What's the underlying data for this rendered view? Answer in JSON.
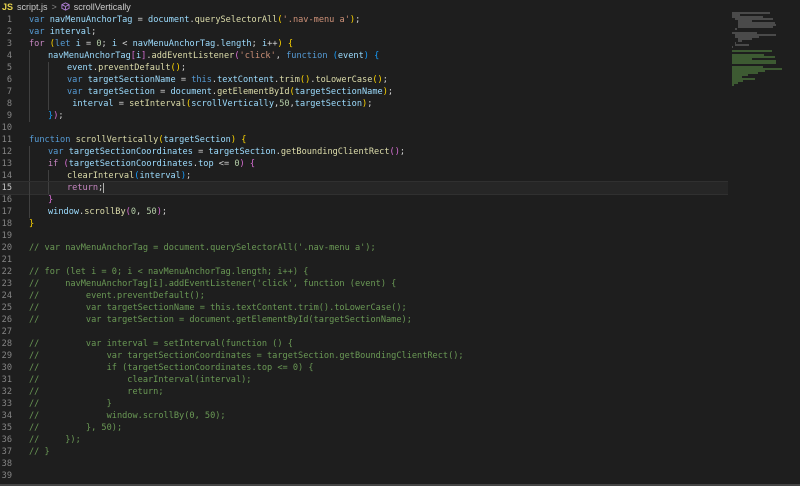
{
  "breadcrumb": {
    "file_badge": "JS",
    "file": "script.js",
    "separator": ">",
    "symbol": "scrollVertically"
  },
  "editor": {
    "current_line": 15,
    "lines": [
      {
        "n": "1",
        "indent": 0,
        "tokens": [
          [
            "k",
            "var "
          ],
          [
            "v",
            "navMenuAnchorTag"
          ],
          [
            "p",
            " = "
          ],
          [
            "v",
            "document"
          ],
          [
            "p",
            "."
          ],
          [
            "f",
            "querySelectorAll"
          ],
          [
            "br",
            "("
          ],
          [
            "s",
            "'.nav-menu a'"
          ],
          [
            "br",
            ")"
          ],
          [
            "p",
            ";"
          ]
        ]
      },
      {
        "n": "2",
        "indent": 0,
        "tokens": [
          [
            "k",
            "var "
          ],
          [
            "v",
            "interval"
          ],
          [
            "p",
            ";"
          ]
        ]
      },
      {
        "n": "3",
        "indent": 0,
        "tokens": [
          [
            "kc",
            "for "
          ],
          [
            "br",
            "("
          ],
          [
            "k",
            "let "
          ],
          [
            "v",
            "i"
          ],
          [
            "p",
            " = "
          ],
          [
            "n",
            "0"
          ],
          [
            "p",
            "; "
          ],
          [
            "v",
            "i"
          ],
          [
            "p",
            " < "
          ],
          [
            "v",
            "navMenuAnchorTag"
          ],
          [
            "p",
            "."
          ],
          [
            "v",
            "length"
          ],
          [
            "p",
            "; "
          ],
          [
            "v",
            "i"
          ],
          [
            "p",
            "++"
          ],
          [
            "br",
            ")"
          ],
          [
            "p",
            " "
          ],
          [
            "br",
            "{"
          ]
        ]
      },
      {
        "n": "4",
        "indent": 1,
        "tokens": [
          [
            "v",
            "navMenuAnchorTag"
          ],
          [
            "br2",
            "["
          ],
          [
            "v",
            "i"
          ],
          [
            "br2",
            "]"
          ],
          [
            "p",
            "."
          ],
          [
            "f",
            "addEventListener"
          ],
          [
            "br2",
            "("
          ],
          [
            "s",
            "'click'"
          ],
          [
            "p",
            ", "
          ],
          [
            "k",
            "function "
          ],
          [
            "br3",
            "("
          ],
          [
            "v",
            "event"
          ],
          [
            "br3",
            ")"
          ],
          [
            "p",
            " "
          ],
          [
            "br3",
            "{"
          ]
        ]
      },
      {
        "n": "5",
        "indent": 2,
        "tokens": [
          [
            "v",
            "event"
          ],
          [
            "p",
            "."
          ],
          [
            "f",
            "preventDefault"
          ],
          [
            "br",
            "()"
          ],
          [
            "p",
            ";"
          ]
        ]
      },
      {
        "n": "6",
        "indent": 2,
        "tokens": [
          [
            "k",
            "var "
          ],
          [
            "v",
            "targetSectionName"
          ],
          [
            "p",
            " = "
          ],
          [
            "k",
            "this"
          ],
          [
            "p",
            "."
          ],
          [
            "v",
            "textContent"
          ],
          [
            "p",
            "."
          ],
          [
            "f",
            "trim"
          ],
          [
            "br",
            "()"
          ],
          [
            "p",
            "."
          ],
          [
            "f",
            "toLowerCase"
          ],
          [
            "br",
            "()"
          ],
          [
            "p",
            ";"
          ]
        ]
      },
      {
        "n": "7",
        "indent": 2,
        "tokens": [
          [
            "k",
            "var "
          ],
          [
            "v",
            "targetSection"
          ],
          [
            "p",
            " = "
          ],
          [
            "v",
            "document"
          ],
          [
            "p",
            "."
          ],
          [
            "f",
            "getElementById"
          ],
          [
            "br",
            "("
          ],
          [
            "v",
            "targetSectionName"
          ],
          [
            "br",
            ")"
          ],
          [
            "p",
            ";"
          ]
        ]
      },
      {
        "n": "8",
        "indent": 2,
        "tokens": [
          [
            "p",
            " "
          ],
          [
            "v",
            "interval"
          ],
          [
            "p",
            " = "
          ],
          [
            "f",
            "setInterval"
          ],
          [
            "br",
            "("
          ],
          [
            "v",
            "scrollVertically"
          ],
          [
            "p",
            ","
          ],
          [
            "n",
            "50"
          ],
          [
            "p",
            ","
          ],
          [
            "v",
            "targetSection"
          ],
          [
            "br",
            ")"
          ],
          [
            "p",
            ";"
          ]
        ]
      },
      {
        "n": "9",
        "indent": 1,
        "tokens": [
          [
            "br3",
            "}"
          ],
          [
            "br2",
            ")"
          ],
          [
            "p",
            ";"
          ]
        ]
      },
      {
        "n": "10",
        "indent": 0,
        "tokens": []
      },
      {
        "n": "11",
        "indent": 0,
        "tokens": [
          [
            "k",
            "function "
          ],
          [
            "f",
            "scrollVertically"
          ],
          [
            "br",
            "("
          ],
          [
            "v",
            "targetSection"
          ],
          [
            "br",
            ")"
          ],
          [
            "p",
            " "
          ],
          [
            "br",
            "{"
          ]
        ]
      },
      {
        "n": "12",
        "indent": 1,
        "tokens": [
          [
            "k",
            "var "
          ],
          [
            "v",
            "targetSectionCoordinates"
          ],
          [
            "p",
            " = "
          ],
          [
            "v",
            "targetSection"
          ],
          [
            "p",
            "."
          ],
          [
            "f",
            "getBoundingClientRect"
          ],
          [
            "br2",
            "()"
          ],
          [
            "p",
            ";"
          ]
        ]
      },
      {
        "n": "13",
        "indent": 1,
        "tokens": [
          [
            "kc",
            "if "
          ],
          [
            "br2",
            "("
          ],
          [
            "v",
            "targetSectionCoordinates"
          ],
          [
            "p",
            "."
          ],
          [
            "v",
            "top"
          ],
          [
            "p",
            " <= "
          ],
          [
            "n",
            "0"
          ],
          [
            "br2",
            ")"
          ],
          [
            "p",
            " "
          ],
          [
            "br2",
            "{"
          ]
        ]
      },
      {
        "n": "14",
        "indent": 2,
        "tokens": [
          [
            "f",
            "clearInterval"
          ],
          [
            "br3",
            "("
          ],
          [
            "v",
            "interval"
          ],
          [
            "br3",
            ")"
          ],
          [
            "p",
            ";"
          ]
        ]
      },
      {
        "n": "15",
        "indent": 2,
        "tokens": [
          [
            "kc",
            "return"
          ],
          [
            "p",
            ";"
          ]
        ]
      },
      {
        "n": "16",
        "indent": 1,
        "tokens": [
          [
            "br2",
            "}"
          ]
        ]
      },
      {
        "n": "17",
        "indent": 1,
        "tokens": [
          [
            "v",
            "window"
          ],
          [
            "p",
            "."
          ],
          [
            "f",
            "scrollBy"
          ],
          [
            "br2",
            "("
          ],
          [
            "n",
            "0"
          ],
          [
            "p",
            ", "
          ],
          [
            "n",
            "50"
          ],
          [
            "br2",
            ")"
          ],
          [
            "p",
            ";"
          ]
        ]
      },
      {
        "n": "18",
        "indent": 0,
        "tokens": [
          [
            "br",
            "}"
          ]
        ]
      },
      {
        "n": "19",
        "indent": 0,
        "tokens": []
      },
      {
        "n": "20",
        "indent": 0,
        "tokens": [
          [
            "c",
            "// var navMenuAnchorTag = document.querySelectorAll('.nav-menu a');"
          ]
        ]
      },
      {
        "n": "21",
        "indent": 0,
        "tokens": []
      },
      {
        "n": "22",
        "indent": 0,
        "tokens": [
          [
            "c",
            "// for (let i = 0; i < navMenuAnchorTag.length; i++) {"
          ]
        ]
      },
      {
        "n": "23",
        "indent": 0,
        "tokens": [
          [
            "c",
            "//     navMenuAnchorTag[i].addEventListener('click', function (event) {"
          ]
        ]
      },
      {
        "n": "24",
        "indent": 0,
        "tokens": [
          [
            "c",
            "//         event.preventDefault();"
          ]
        ]
      },
      {
        "n": "25",
        "indent": 0,
        "tokens": [
          [
            "c",
            "//         var targetSectionName = this.textContent.trim().toLowerCase();"
          ]
        ]
      },
      {
        "n": "26",
        "indent": 0,
        "tokens": [
          [
            "c",
            "//         var targetSection = document.getElementById(targetSectionName);"
          ]
        ]
      },
      {
        "n": "27",
        "indent": 0,
        "tokens": []
      },
      {
        "n": "28",
        "indent": 0,
        "tokens": [
          [
            "c",
            "//         var interval = setInterval(function () {"
          ]
        ]
      },
      {
        "n": "29",
        "indent": 0,
        "tokens": [
          [
            "c",
            "//             var targetSectionCoordinates = targetSection.getBoundingClientRect();"
          ]
        ]
      },
      {
        "n": "30",
        "indent": 0,
        "tokens": [
          [
            "c",
            "//             if (targetSectionCoordinates.top <= 0) {"
          ]
        ]
      },
      {
        "n": "31",
        "indent": 0,
        "tokens": [
          [
            "c",
            "//                 clearInterval(interval);"
          ]
        ]
      },
      {
        "n": "32",
        "indent": 0,
        "tokens": [
          [
            "c",
            "//                 return;"
          ]
        ]
      },
      {
        "n": "33",
        "indent": 0,
        "tokens": [
          [
            "c",
            "//             }"
          ]
        ]
      },
      {
        "n": "34",
        "indent": 0,
        "tokens": [
          [
            "c",
            "//             window.scrollBy(0, 50);"
          ]
        ]
      },
      {
        "n": "35",
        "indent": 0,
        "tokens": [
          [
            "c",
            "//         }, 50);"
          ]
        ]
      },
      {
        "n": "36",
        "indent": 0,
        "tokens": [
          [
            "c",
            "//     });"
          ]
        ]
      },
      {
        "n": "37",
        "indent": 0,
        "tokens": [
          [
            "c",
            "// }"
          ]
        ]
      },
      {
        "n": "38",
        "indent": 0,
        "tokens": []
      },
      {
        "n": "39",
        "indent": 0,
        "tokens": []
      }
    ]
  },
  "colors": {
    "background": "#1e1e1e",
    "keyword": "#569cd6",
    "control": "#c586c0",
    "function": "#dcdcaa",
    "variable": "#9cdcfe",
    "string": "#ce9178",
    "number": "#b5cea8",
    "comment": "#6a9955"
  },
  "icons": {
    "symbol": "method-cube-icon"
  }
}
